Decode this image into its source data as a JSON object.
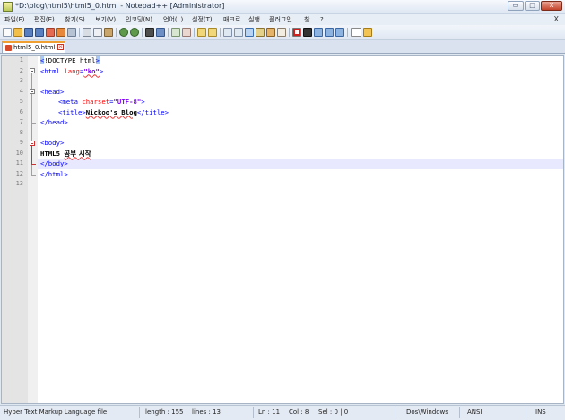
{
  "window": {
    "title": "*D:\\blog\\html5\\html5_0.html - Notepad++ [Administrator]",
    "controls": {
      "minimize": "▭",
      "maximize": "□",
      "close": "X"
    }
  },
  "menu": {
    "items": [
      "파일(F)",
      "편집(E)",
      "찾기(S)",
      "보기(V)",
      "인코딩(N)",
      "언어(L)",
      "설정(T)",
      "매크로",
      "실행",
      "플러그인",
      "창",
      "?"
    ],
    "close_label": "X"
  },
  "tabs": [
    {
      "label": "html5_0.html",
      "close": "x"
    }
  ],
  "editor": {
    "line_numbers": [
      "1",
      "2",
      "3",
      "4",
      "5",
      "6",
      "7",
      "8",
      "9",
      "10",
      "11",
      "12",
      "13"
    ],
    "lines": {
      "l1_open": "<",
      "l1_doctype": "!DOCTYPE html",
      "l1_close": ">",
      "l2_tag": "<html ",
      "l2_attr": "lang",
      "l2_eq": "=",
      "l2_val": "\"ko\"",
      "l2_end": ">",
      "l4": "<head>",
      "l5_tag": "<meta ",
      "l5_attr": "charset",
      "l5_eq": "=",
      "l5_val": "\"UTF-8\"",
      "l5_end": ">",
      "l6_open": "<title>",
      "l6_text": "Nickoo's Blog",
      "l6_close": "</title>",
      "l7": "</head>",
      "l9": "<body>",
      "l10_latin": "HTML5 ",
      "l10_kor": "공부 시작",
      "l11": "</body>",
      "l12": "</html>"
    }
  },
  "status": {
    "language": "Hyper Text Markup Language file",
    "length": "length : 155",
    "lines": "lines : 13",
    "ln": "Ln : 11",
    "col": "Col : 8",
    "sel": "Sel : 0 | 0",
    "eol": "Dos\\Windows",
    "encoding": "ANSI",
    "mode": "INS"
  }
}
